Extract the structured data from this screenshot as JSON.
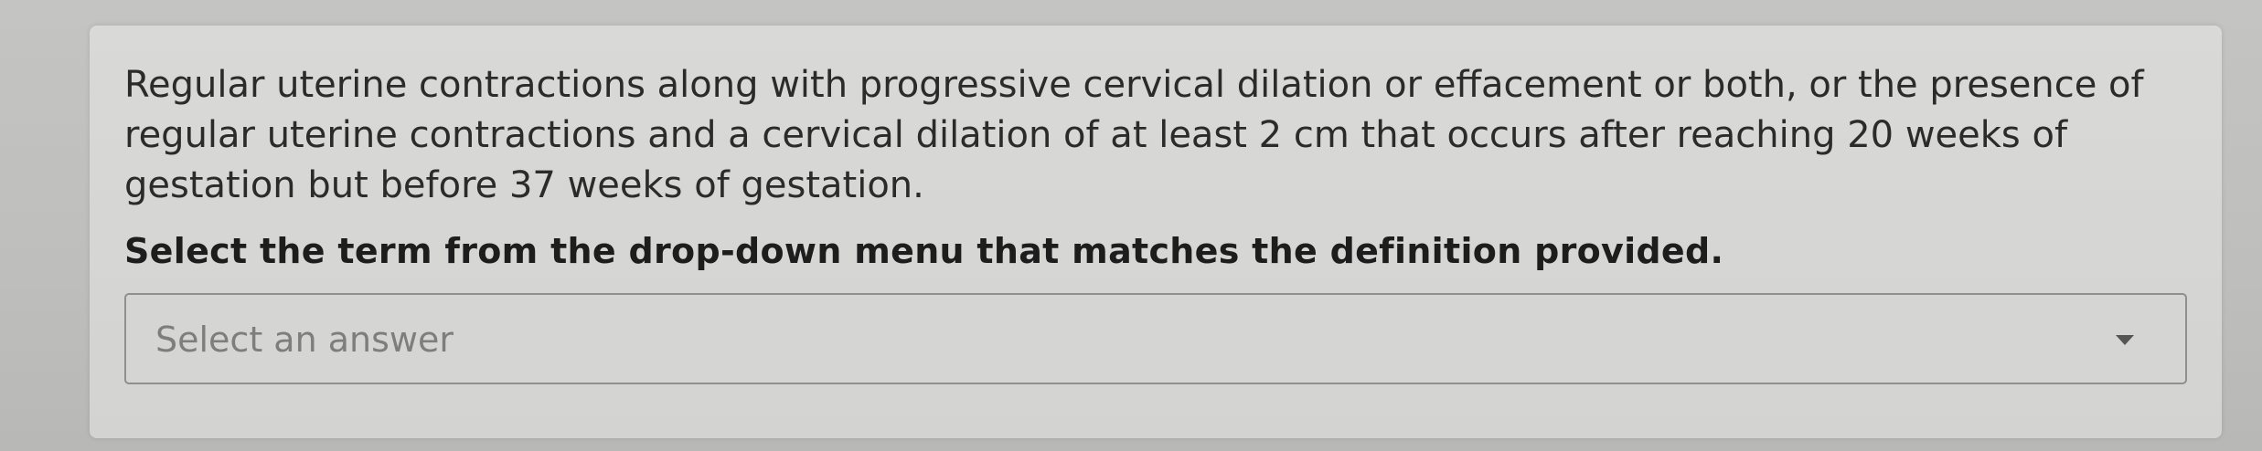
{
  "question": {
    "definition": "Regular uterine contractions along with progressive cervical dilation or effacement or both, or the presence of regular uterine contractions and a cervical dilation of at least 2 cm that occurs after reaching 20 weeks of gestation but before 37 weeks of gestation.",
    "prompt": "Select the term from the drop-down menu that matches the definition provided."
  },
  "answer_dropdown": {
    "placeholder": "Select an answer",
    "icon": "caret-down-icon"
  }
}
